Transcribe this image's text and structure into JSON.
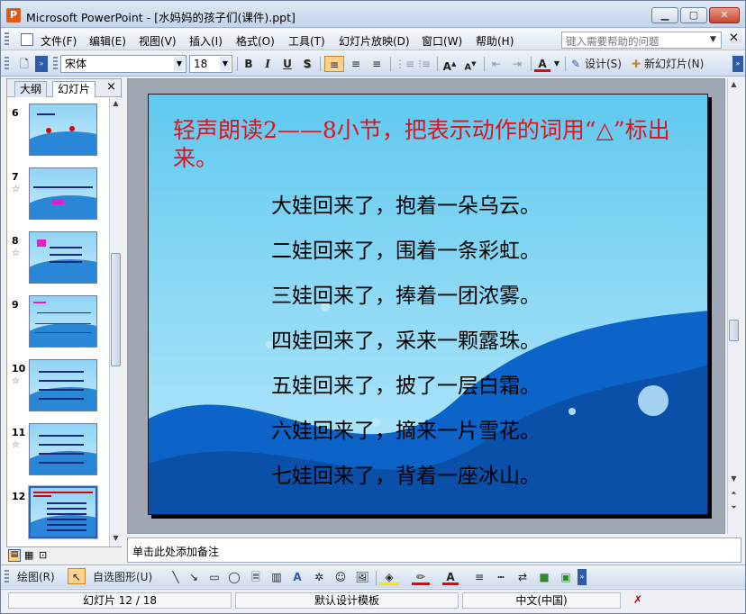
{
  "window": {
    "title": "Microsoft PowerPoint - [水妈妈的孩子们(课件).ppt]",
    "app_icon": "P"
  },
  "menu": {
    "items": [
      "文件(F)",
      "编辑(E)",
      "视图(V)",
      "插入(I)",
      "格式(O)",
      "工具(T)",
      "幻灯片放映(D)",
      "窗口(W)",
      "帮助(H)"
    ],
    "help_placeholder": "键入需要帮助的问题"
  },
  "toolbar": {
    "font_name": "宋体",
    "font_size": "18",
    "bold": "B",
    "italic": "I",
    "underline": "U",
    "shadow": "S",
    "design_label": "设计(S)",
    "new_slide_label": "新幻灯片(N)"
  },
  "left_pane": {
    "tab_outline": "大纲",
    "tab_slides": "幻灯片",
    "close": "×",
    "thumbnails": [
      {
        "number": "6",
        "star": ""
      },
      {
        "number": "7",
        "star": "☆"
      },
      {
        "number": "8",
        "star": "☆"
      },
      {
        "number": "9",
        "star": ""
      },
      {
        "number": "10",
        "star": "☆"
      },
      {
        "number": "11",
        "star": "☆"
      },
      {
        "number": "12",
        "star": ""
      }
    ],
    "selected_slide": "12"
  },
  "slide": {
    "title": "轻声朗读2——8小节，把表示动作的词用“△”标出来。",
    "lines": [
      "大娃回来了，抱着一朵乌云。",
      "二娃回来了，围着一条彩虹。",
      "三娃回来了，捧着一团浓雾。",
      "四娃回来了，采来一颗露珠。",
      "五娃回来了，披了一层白霜。",
      "六娃回来了，摘来一片雪花。",
      "七娃回来了，背着一座冰山。"
    ],
    "title_color": "#e0121c"
  },
  "notes": {
    "placeholder": "单击此处添加备注"
  },
  "drawing_toolbar": {
    "draw_label": "绘图(R)",
    "autoshapes_label": "自选图形(U)"
  },
  "status": {
    "slide_info": "幻灯片 12 / 18",
    "template": "默认设计模板",
    "language": "中文(中国)"
  }
}
